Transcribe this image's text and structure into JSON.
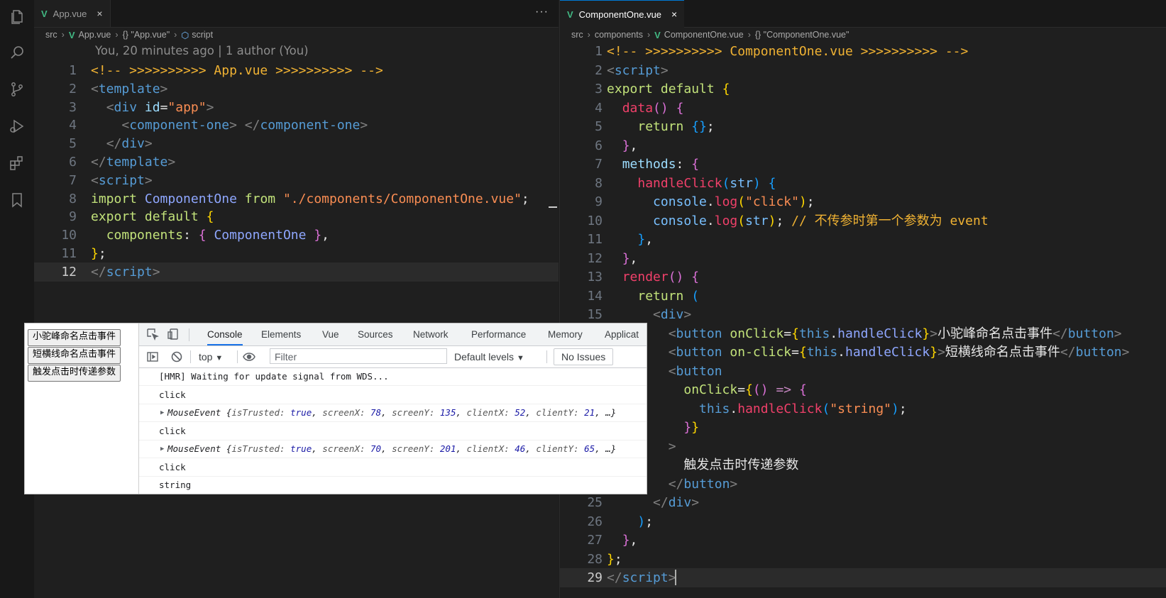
{
  "colors": {
    "accent": "#0078d4",
    "vue_green": "#41b883",
    "editor_bg": "#1f1f1f"
  },
  "activity_bar": {
    "icons": [
      "files-icon",
      "search-icon",
      "source-control-icon",
      "run-debug-icon",
      "extensions-icon",
      "bookmark-icon"
    ]
  },
  "left": {
    "tab": {
      "label": "App.vue",
      "close": "×"
    },
    "more": "···",
    "breadcrumb": [
      "src",
      "App.vue",
      "{} \"App.vue\"",
      "script"
    ],
    "blame": "You, 20 minutes ago | 1 author (You)"
  },
  "right": {
    "tab": {
      "label": "ComponentOne.vue",
      "close": "×"
    },
    "breadcrumb": [
      "src",
      "components",
      "ComponentOne.vue",
      "{} \"ComponentOne.vue\""
    ]
  },
  "left_code": [
    {
      "n": "1",
      "parts": [
        [
          "t-com",
          "<!-- >>>>>>>>>> App.vue >>>>>>>>>> -->"
        ]
      ]
    },
    {
      "n": "2",
      "parts": [
        [
          "t-punc",
          "<"
        ],
        [
          "t-tag",
          "template"
        ],
        [
          "t-punc",
          ">"
        ]
      ]
    },
    {
      "n": "3",
      "parts": [
        [
          "t-plain",
          "  "
        ],
        [
          "t-punc",
          "<"
        ],
        [
          "t-tag",
          "div"
        ],
        [
          "t-plain",
          " "
        ],
        [
          "t-attr",
          "id"
        ],
        [
          "t-plain",
          "="
        ],
        [
          "t-str",
          "\"app\""
        ],
        [
          "t-punc",
          ">"
        ]
      ]
    },
    {
      "n": "4",
      "parts": [
        [
          "t-plain",
          "    "
        ],
        [
          "t-punc",
          "<"
        ],
        [
          "t-tag",
          "component-one"
        ],
        [
          "t-punc",
          ">"
        ],
        [
          "t-plain",
          " "
        ],
        [
          "t-punc",
          "</"
        ],
        [
          "t-tag",
          "component-one"
        ],
        [
          "t-punc",
          ">"
        ]
      ]
    },
    {
      "n": "5",
      "parts": [
        [
          "t-plain",
          "  "
        ],
        [
          "t-punc",
          "</"
        ],
        [
          "t-tag",
          "div"
        ],
        [
          "t-punc",
          ">"
        ]
      ]
    },
    {
      "n": "6",
      "parts": [
        [
          "t-punc",
          "</"
        ],
        [
          "t-tag",
          "template"
        ],
        [
          "t-punc",
          ">"
        ]
      ]
    },
    {
      "n": "7",
      "parts": [
        [
          "t-punc",
          "<"
        ],
        [
          "t-tag",
          "script"
        ],
        [
          "t-punc",
          ">"
        ]
      ]
    },
    {
      "n": "8",
      "parts": [
        [
          "t-def",
          "import"
        ],
        [
          "t-plain",
          " "
        ],
        [
          "t-comp",
          "ComponentOne"
        ],
        [
          "t-plain",
          " "
        ],
        [
          "t-def",
          "from"
        ],
        [
          "t-plain",
          " "
        ],
        [
          "t-str",
          "\"./components/ComponentOne.vue\""
        ],
        [
          "t-plain",
          ";"
        ]
      ]
    },
    {
      "n": "9",
      "parts": [
        [
          "t-def",
          "export"
        ],
        [
          "t-plain",
          " "
        ],
        [
          "t-def",
          "default"
        ],
        [
          "t-plain",
          " "
        ],
        [
          "t-br1",
          "{"
        ]
      ]
    },
    {
      "n": "10",
      "parts": [
        [
          "t-plain",
          "  "
        ],
        [
          "t-def",
          "components"
        ],
        [
          "t-plain",
          ": "
        ],
        [
          "t-br2",
          "{"
        ],
        [
          "t-plain",
          " "
        ],
        [
          "t-comp",
          "ComponentOne"
        ],
        [
          "t-plain",
          " "
        ],
        [
          "t-br2",
          "}"
        ],
        [
          "t-plain",
          ","
        ]
      ]
    },
    {
      "n": "11",
      "parts": [
        [
          "t-br1",
          "}"
        ],
        [
          "t-plain",
          ";"
        ]
      ]
    },
    {
      "n": "12",
      "parts": [
        [
          "t-punc",
          "</"
        ],
        [
          "t-tag",
          "script"
        ],
        [
          "t-punc",
          ">"
        ]
      ]
    }
  ],
  "right_code": [
    {
      "n": "1",
      "parts": [
        [
          "t-com",
          "<!-- >>>>>>>>>> ComponentOne.vue >>>>>>>>>> -->"
        ]
      ]
    },
    {
      "n": "2",
      "parts": [
        [
          "t-punc",
          "<"
        ],
        [
          "t-tag",
          "script"
        ],
        [
          "t-punc",
          ">"
        ]
      ]
    },
    {
      "n": "3",
      "parts": [
        [
          "t-def",
          "export"
        ],
        [
          "t-plain",
          " "
        ],
        [
          "t-def",
          "default"
        ],
        [
          "t-plain",
          " "
        ],
        [
          "t-br1",
          "{"
        ]
      ]
    },
    {
      "n": "4",
      "parts": [
        [
          "t-plain",
          "  "
        ],
        [
          "t-fn",
          "data"
        ],
        [
          "t-br2",
          "()"
        ],
        [
          "t-plain",
          " "
        ],
        [
          "t-br2",
          "{"
        ]
      ]
    },
    {
      "n": "5",
      "parts": [
        [
          "t-plain",
          "    "
        ],
        [
          "t-def",
          "return"
        ],
        [
          "t-plain",
          " "
        ],
        [
          "t-br3",
          "{}"
        ],
        [
          "t-plain",
          ";"
        ]
      ]
    },
    {
      "n": "6",
      "parts": [
        [
          "t-plain",
          "  "
        ],
        [
          "t-br2",
          "}"
        ],
        [
          "t-plain",
          ","
        ]
      ]
    },
    {
      "n": "7",
      "parts": [
        [
          "t-plain",
          "  "
        ],
        [
          "t-prop",
          "methods"
        ],
        [
          "t-plain",
          ": "
        ],
        [
          "t-br2",
          "{"
        ]
      ]
    },
    {
      "n": "8",
      "parts": [
        [
          "t-plain",
          "    "
        ],
        [
          "t-fn",
          "handleClick"
        ],
        [
          "t-br3",
          "("
        ],
        [
          "t-var",
          "str"
        ],
        [
          "t-br3",
          ")"
        ],
        [
          "t-plain",
          " "
        ],
        [
          "t-br3",
          "{"
        ]
      ]
    },
    {
      "n": "9",
      "parts": [
        [
          "t-plain",
          "      "
        ],
        [
          "t-var",
          "console"
        ],
        [
          "t-plain",
          "."
        ],
        [
          "t-fn",
          "log"
        ],
        [
          "t-br1",
          "("
        ],
        [
          "t-str",
          "\"click\""
        ],
        [
          "t-br1",
          ")"
        ],
        [
          "t-plain",
          ";"
        ]
      ]
    },
    {
      "n": "10",
      "parts": [
        [
          "t-plain",
          "      "
        ],
        [
          "t-var",
          "console"
        ],
        [
          "t-plain",
          "."
        ],
        [
          "t-fn",
          "log"
        ],
        [
          "t-br1",
          "("
        ],
        [
          "t-var",
          "str"
        ],
        [
          "t-br1",
          ")"
        ],
        [
          "t-plain",
          "; "
        ],
        [
          "t-com",
          "// 不传参时第一个参数为 event"
        ]
      ]
    },
    {
      "n": "11",
      "parts": [
        [
          "t-plain",
          "    "
        ],
        [
          "t-br3",
          "}"
        ],
        [
          "t-plain",
          ","
        ]
      ]
    },
    {
      "n": "12",
      "parts": [
        [
          "t-plain",
          "  "
        ],
        [
          "t-br2",
          "}"
        ],
        [
          "t-plain",
          ","
        ]
      ]
    },
    {
      "n": "13",
      "parts": [
        [
          "t-plain",
          "  "
        ],
        [
          "t-fn",
          "render"
        ],
        [
          "t-br2",
          "()"
        ],
        [
          "t-plain",
          " "
        ],
        [
          "t-br2",
          "{"
        ]
      ]
    },
    {
      "n": "14",
      "parts": [
        [
          "t-plain",
          "    "
        ],
        [
          "t-def",
          "return"
        ],
        [
          "t-plain",
          " "
        ],
        [
          "t-br3",
          "("
        ]
      ]
    },
    {
      "n": "15",
      "parts": [
        [
          "t-plain",
          "      "
        ],
        [
          "t-punc",
          "<"
        ],
        [
          "t-tag",
          "div"
        ],
        [
          "t-punc",
          ">"
        ]
      ]
    },
    {
      "n": "",
      "parts": [
        [
          "t-plain",
          "        "
        ],
        [
          "t-punc",
          "<"
        ],
        [
          "t-tag",
          "button"
        ],
        [
          "t-plain",
          " "
        ],
        [
          "t-def",
          "onClick"
        ],
        [
          "t-plain",
          "="
        ],
        [
          "t-br1",
          "{"
        ],
        [
          "t-this",
          "this"
        ],
        [
          "t-plain",
          "."
        ],
        [
          "t-comp",
          "handleClick"
        ],
        [
          "t-br1",
          "}"
        ],
        [
          "t-punc",
          ">"
        ],
        [
          "t-plain",
          "小驼峰命名点击事件"
        ],
        [
          "t-punc",
          "</"
        ],
        [
          "t-tag",
          "button"
        ],
        [
          "t-punc",
          ">"
        ]
      ]
    },
    {
      "n": "",
      "parts": [
        [
          "t-plain",
          "        "
        ],
        [
          "t-punc",
          "<"
        ],
        [
          "t-tag",
          "button"
        ],
        [
          "t-plain",
          " "
        ],
        [
          "t-def",
          "on-click"
        ],
        [
          "t-plain",
          "="
        ],
        [
          "t-br1",
          "{"
        ],
        [
          "t-this",
          "this"
        ],
        [
          "t-plain",
          "."
        ],
        [
          "t-comp",
          "handleClick"
        ],
        [
          "t-br1",
          "}"
        ],
        [
          "t-punc",
          ">"
        ],
        [
          "t-plain",
          "短横线命名点击事件"
        ],
        [
          "t-punc",
          "</"
        ],
        [
          "t-tag",
          "button"
        ],
        [
          "t-punc",
          ">"
        ]
      ]
    },
    {
      "n": "",
      "parts": [
        [
          "t-plain",
          "        "
        ],
        [
          "t-punc",
          "<"
        ],
        [
          "t-tag",
          "button"
        ]
      ]
    },
    {
      "n": "",
      "parts": [
        [
          "t-plain",
          "          "
        ],
        [
          "t-def",
          "onClick"
        ],
        [
          "t-plain",
          "="
        ],
        [
          "t-br1",
          "{"
        ],
        [
          "t-br2",
          "()"
        ],
        [
          "t-plain",
          " "
        ],
        [
          "t-arrow",
          "=>"
        ],
        [
          "t-plain",
          " "
        ],
        [
          "t-br2",
          "{"
        ]
      ]
    },
    {
      "n": "",
      "parts": [
        [
          "t-plain",
          "            "
        ],
        [
          "t-this",
          "this"
        ],
        [
          "t-plain",
          "."
        ],
        [
          "t-fn",
          "handleClick"
        ],
        [
          "t-br3",
          "("
        ],
        [
          "t-str",
          "\"string\""
        ],
        [
          "t-br3",
          ")"
        ],
        [
          "t-plain",
          ";"
        ]
      ]
    },
    {
      "n": "",
      "parts": [
        [
          "t-plain",
          "          "
        ],
        [
          "t-br2",
          "}"
        ],
        [
          "t-br1",
          "}"
        ]
      ]
    },
    {
      "n": "",
      "parts": [
        [
          "t-plain",
          "        "
        ],
        [
          "t-punc",
          ">"
        ]
      ]
    },
    {
      "n": "",
      "parts": [
        [
          "t-plain",
          "          "
        ],
        [
          "t-plain",
          "触发点击时传递参数"
        ]
      ]
    },
    {
      "n": "",
      "parts": [
        [
          "t-plain",
          "        "
        ],
        [
          "t-punc",
          "</"
        ],
        [
          "t-tag",
          "button"
        ],
        [
          "t-punc",
          ">"
        ]
      ]
    },
    {
      "n": "25",
      "parts": [
        [
          "t-plain",
          "      "
        ],
        [
          "t-punc",
          "</"
        ],
        [
          "t-tag",
          "div"
        ],
        [
          "t-punc",
          ">"
        ]
      ]
    },
    {
      "n": "26",
      "parts": [
        [
          "t-plain",
          "    "
        ],
        [
          "t-br3",
          ")"
        ],
        [
          "t-plain",
          ";"
        ]
      ]
    },
    {
      "n": "27",
      "parts": [
        [
          "t-plain",
          "  "
        ],
        [
          "t-br2",
          "}"
        ],
        [
          "t-plain",
          ","
        ]
      ]
    },
    {
      "n": "28",
      "parts": [
        [
          "t-br1",
          "}"
        ],
        [
          "t-plain",
          ";"
        ]
      ]
    },
    {
      "n": "29",
      "parts": [
        [
          "t-punc",
          "</"
        ],
        [
          "t-tag",
          "script"
        ],
        [
          "t-punc",
          ">"
        ]
      ]
    }
  ],
  "browser": {
    "page_buttons": [
      "小驼峰命名点击事件",
      "短横线命名点击事件",
      "触发点击时传递参数"
    ],
    "devtools_tabs": [
      "Console",
      "Elements",
      "Vue",
      "Sources",
      "Network",
      "Performance",
      "Memory",
      "Applicat"
    ],
    "toolbar": {
      "context": "top",
      "filter_placeholder": "Filter",
      "levels": "Default levels",
      "issues": "No Issues"
    },
    "console": [
      {
        "type": "text",
        "text": "[HMR] Waiting for update signal from WDS..."
      },
      {
        "type": "text",
        "text": "click"
      },
      {
        "type": "event",
        "name": "MouseEvent",
        "isTrusted": "true",
        "screenX": "78",
        "screenY": "135",
        "clientX": "52",
        "clientY": "21"
      },
      {
        "type": "text",
        "text": "click"
      },
      {
        "type": "event",
        "name": "MouseEvent",
        "isTrusted": "true",
        "screenX": "70",
        "screenY": "201",
        "clientX": "46",
        "clientY": "65"
      },
      {
        "type": "text",
        "text": "click"
      },
      {
        "type": "text",
        "text": "string"
      }
    ]
  }
}
